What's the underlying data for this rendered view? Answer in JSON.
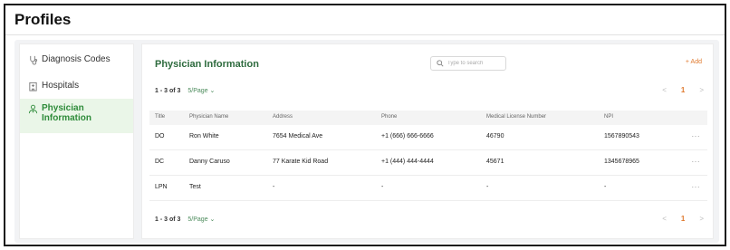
{
  "page": {
    "title": "Profiles"
  },
  "sidebar": {
    "items": [
      {
        "label": "Diagnosis Codes",
        "icon": "stethoscope-icon",
        "active": false
      },
      {
        "label": "Hospitals",
        "icon": "hospital-icon",
        "active": false
      },
      {
        "label": "Physician Information",
        "label_line1": "Physician",
        "label_line2": "Information",
        "icon": "user-doctor-icon",
        "active": true
      }
    ]
  },
  "main": {
    "title": "Physician Information",
    "search_placeholder": "Type to search",
    "add_label": "+ Add",
    "pager_top": {
      "count": "1 - 3 of 3",
      "page_size": "5/Page ⌄",
      "prev": "<",
      "current": "1",
      "next": ">"
    },
    "pager_bottom": {
      "count": "1 - 3 of 3",
      "page_size": "5/Page ⌄",
      "prev": "<",
      "current": "1",
      "next": ">"
    },
    "table": {
      "headers": [
        "Title",
        "Physician Name",
        "Address",
        "Phone",
        "Medical License Number",
        "NPI"
      ],
      "rows": [
        {
          "title": "DO",
          "name": "Ron White",
          "address": "7654 Medical Ave",
          "phone": "+1 (666) 666-6666",
          "license": "46790",
          "npi": "1567890543",
          "actions": "···"
        },
        {
          "title": "DC",
          "name": "Danny Caruso",
          "address": "77 Karate Kid Road",
          "phone": "+1 (444) 444-4444",
          "license": "45671",
          "npi": "1345678965",
          "actions": "···"
        },
        {
          "title": "LPN",
          "name": "Test",
          "address": "-",
          "phone": "-",
          "license": "-",
          "npi": "-",
          "actions": "···"
        }
      ]
    }
  },
  "colors": {
    "accent_green": "#2e8b3a",
    "title_green": "#2e6b3e",
    "accent_orange": "#e07a2f",
    "active_bg": "#eaf6e8"
  }
}
